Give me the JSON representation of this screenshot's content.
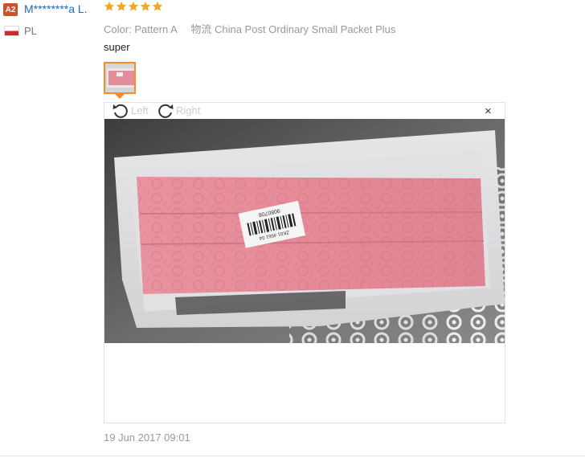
{
  "user": {
    "level": "A2",
    "name": "M********a L.",
    "country": "PL"
  },
  "review": {
    "rating": 5,
    "max_rating": 5,
    "color_label": "Color:",
    "color_value": "Pattern A",
    "shipping_label": "物流",
    "shipping_value": "China Post Ordinary Small Packet Plus",
    "text": "super",
    "date": "19 Jun 2017 09:01"
  },
  "viewer": {
    "rotate_left_label": "Left",
    "rotate_right_label": "Right",
    "close_label": "×"
  },
  "photo": {
    "label_line1": "9080708",
    "label_line2": "ZK01 4561 04"
  },
  "colors": {
    "star": "#f5a623",
    "name_link": "#2269b5",
    "badge": "#d0502b",
    "thumb_border": "#f58c2a",
    "pink_mat": "#e5909c"
  },
  "icons": {
    "rotate_left": "rotate-left-icon",
    "rotate_right": "rotate-right-icon",
    "close": "close-icon",
    "flag": "poland-flag-icon",
    "star": "star-icon"
  }
}
